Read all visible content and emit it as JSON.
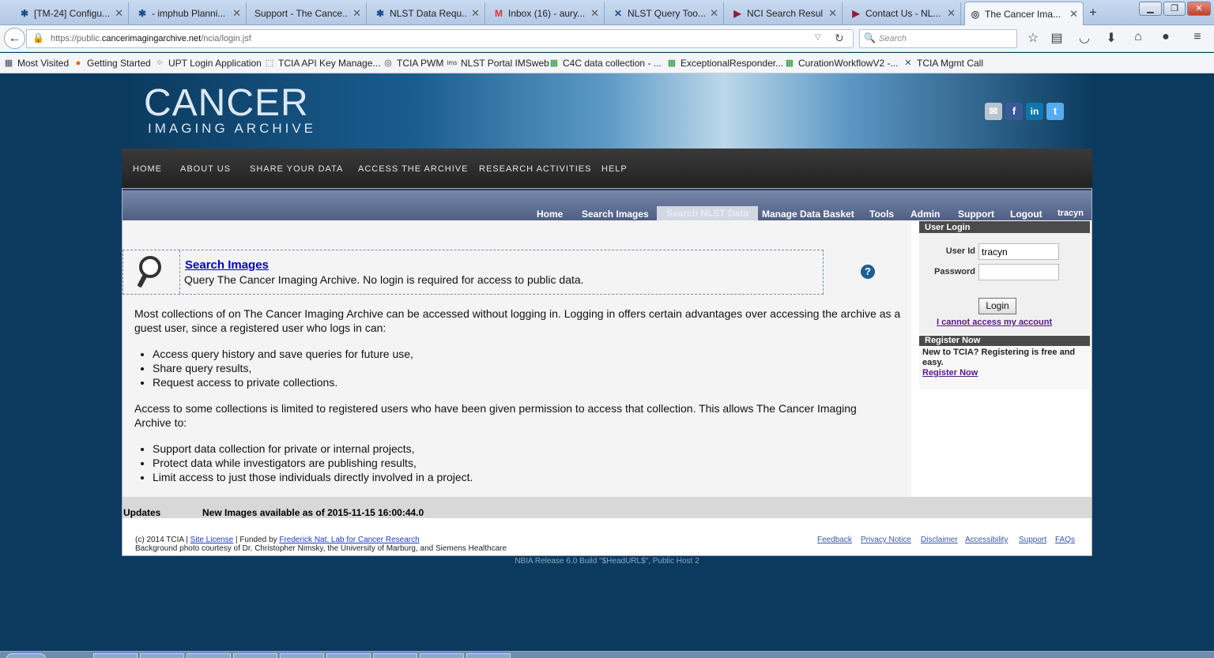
{
  "browser": {
    "tabs": [
      {
        "title": "[TM-24] Configu...",
        "icon": "tcia-icon"
      },
      {
        "title": "- imphub Planni...",
        "icon": "tcia-icon"
      },
      {
        "title": "Support - The Cance...",
        "icon": "none"
      },
      {
        "title": "NLST Data Requ...",
        "icon": "tcia-icon"
      },
      {
        "title": "Inbox (16) - aury...",
        "icon": "gmail-icon"
      },
      {
        "title": "NLST Query Too...",
        "icon": "nlst-icon"
      },
      {
        "title": "NCI Search Resul...",
        "icon": "nci-icon"
      },
      {
        "title": "Contact Us - NL...",
        "icon": "nci-icon"
      },
      {
        "title": "The Cancer Ima...",
        "icon": "tcia-icon"
      }
    ],
    "url_prefix": "https://public.",
    "url_domain": "cancerimagingarchive.net",
    "url_path": "/ncia/login.jsf",
    "search_placeholder": "Search",
    "bookmarks": [
      "Most Visited",
      "Getting Started",
      "UPT Login Application",
      "TCIA API Key Manage...",
      "TCIA PWM",
      "NLST Portal IMSweb",
      "C4C data collection - ...",
      "ExceptionalResponder...",
      "CurationWorkflowV2 -...",
      "TCIA Mgmt Call"
    ]
  },
  "banner": {
    "logo_line1": "CANCER",
    "logo_line2": "IMAGING ARCHIVE"
  },
  "main_nav": [
    "HOME",
    "ABOUT US",
    "SHARE YOUR DATA",
    "ACCESS THE ARCHIVE",
    "RESEARCH ACTIVITIES",
    "HELP"
  ],
  "app_nav": {
    "items": [
      "Home",
      "Search Images",
      "Search NLST Data",
      "Manage Data Basket",
      "Tools",
      "Admin",
      "Support",
      "Logout"
    ],
    "selected": "Search NLST Data",
    "username": "tracyn"
  },
  "search_panel": {
    "link": "Search Images",
    "description": "Query The Cancer Imaging Archive. No login is required for access to public data."
  },
  "body": {
    "para1": "Most collections of on The Cancer Imaging Archive can be accessed without logging in. Logging in offers certain advantages over accessing the archive as a guest user, since a registered user who logs in can:",
    "list1": [
      "Access query history and save queries for future use,",
      "Share query results,",
      "Request access to private collections."
    ],
    "para2": "Access to some collections is limited to registered users who have been given permission to access that collection. This allows The Cancer Imaging Archive to:",
    "list2": [
      "Support data collection for private or internal projects,",
      "Protect data while investigators are publishing results,",
      "Limit access to just those individuals directly involved in a project."
    ]
  },
  "login": {
    "header": "User Login",
    "userid_label": "User Id",
    "userid_value": "tracyn",
    "password_label": "Password",
    "password_value": "",
    "button": "Login",
    "cannot_access": "I cannot access my account"
  },
  "register": {
    "header": "Register Now",
    "text": "New to TCIA? Registering is free and easy.",
    "link": "Register Now"
  },
  "updates": {
    "label": "Updates",
    "text": "New Images available as of 2015-11-15 16:00:44.0"
  },
  "footer": {
    "copy_prefix": "(c) 2014 TCIA |",
    "site_license": "Site License",
    "funded_prefix": "| Funded by",
    "funder": "Frederick Nat. Lab for Cancer Research",
    "photo_credit": "Background photo courtesy of Dr. Christopher Nimsky, the University of Marburg, and Siemens Healthcare",
    "links": [
      "Feedback",
      "Privacy Notice",
      "Disclaimer",
      "Accessibility",
      "Support",
      "FAQs"
    ],
    "release": "NBIA Release 6.0 Build \"$HeadURL$\", Public Host 2"
  },
  "colors": {
    "page_bg": "#0b3a5e",
    "nav_bg": "#2a2a2a",
    "app_nav_bg": "#5b6b8f",
    "link": "#0000cc"
  }
}
